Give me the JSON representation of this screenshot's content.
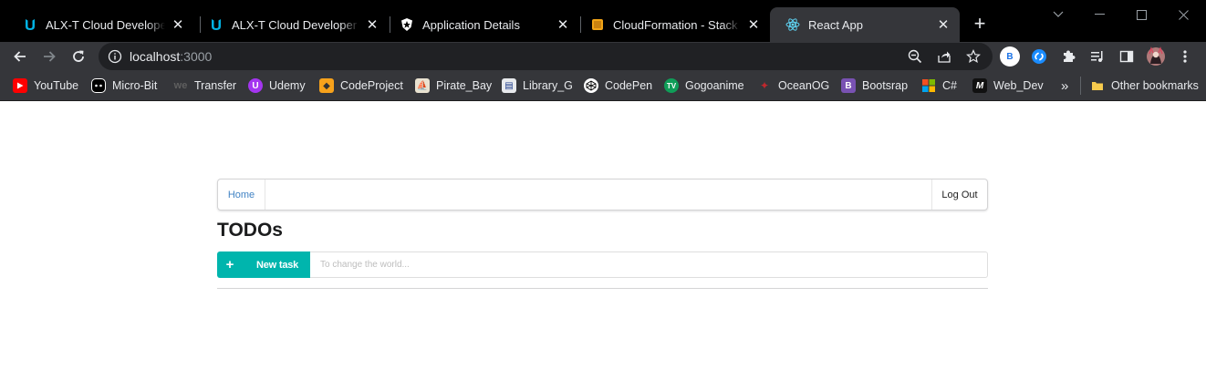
{
  "tabs": [
    {
      "title": "ALX-T Cloud Developer - Udacity",
      "icon": "udacity-icon"
    },
    {
      "title": "ALX-T Cloud Developer - Udacity",
      "icon": "udacity-icon"
    },
    {
      "title": "Application Details",
      "icon": "auth0-icon"
    },
    {
      "title": "CloudFormation - Stack",
      "icon": "aws-icon"
    },
    {
      "title": "React App",
      "icon": "react-icon",
      "active": true
    }
  ],
  "address": {
    "host": "localhost",
    "port": ":3000"
  },
  "profile": {
    "initial": "B"
  },
  "bookmarks": [
    {
      "label": "YouTube",
      "icon": "youtube-icon"
    },
    {
      "label": "Micro-Bit",
      "icon": "microbit-icon"
    },
    {
      "label": "Transfer",
      "icon": "transfer-icon"
    },
    {
      "label": "Udemy",
      "icon": "udemy-icon"
    },
    {
      "label": "CodeProject",
      "icon": "codeproject-icon"
    },
    {
      "label": "Pirate_Bay",
      "icon": "piratebay-icon"
    },
    {
      "label": "Library_G",
      "icon": "library-icon"
    },
    {
      "label": "CodePen",
      "icon": "codepen-icon"
    },
    {
      "label": "Gogoanime",
      "icon": "gogoanime-icon"
    },
    {
      "label": "OceanOG",
      "icon": "oceanog-icon"
    },
    {
      "label": "Bootsrap",
      "icon": "bootstrap-icon"
    },
    {
      "label": "C#",
      "icon": "windows-icon"
    },
    {
      "label": "Web_Dev",
      "icon": "webdev-icon"
    }
  ],
  "bookmarks_more": "»",
  "other_bookmarks": "Other bookmarks",
  "app": {
    "menu": {
      "home": "Home",
      "logout": "Log Out"
    },
    "heading": "TODOs",
    "new_task": {
      "plus": "+",
      "label": "New task"
    },
    "input_placeholder": "To change the world..."
  },
  "colors": {
    "accent": "#00b5ad",
    "link": "#4183c4",
    "chrome_dark": "#35363a",
    "tabstrip": "#000000"
  }
}
